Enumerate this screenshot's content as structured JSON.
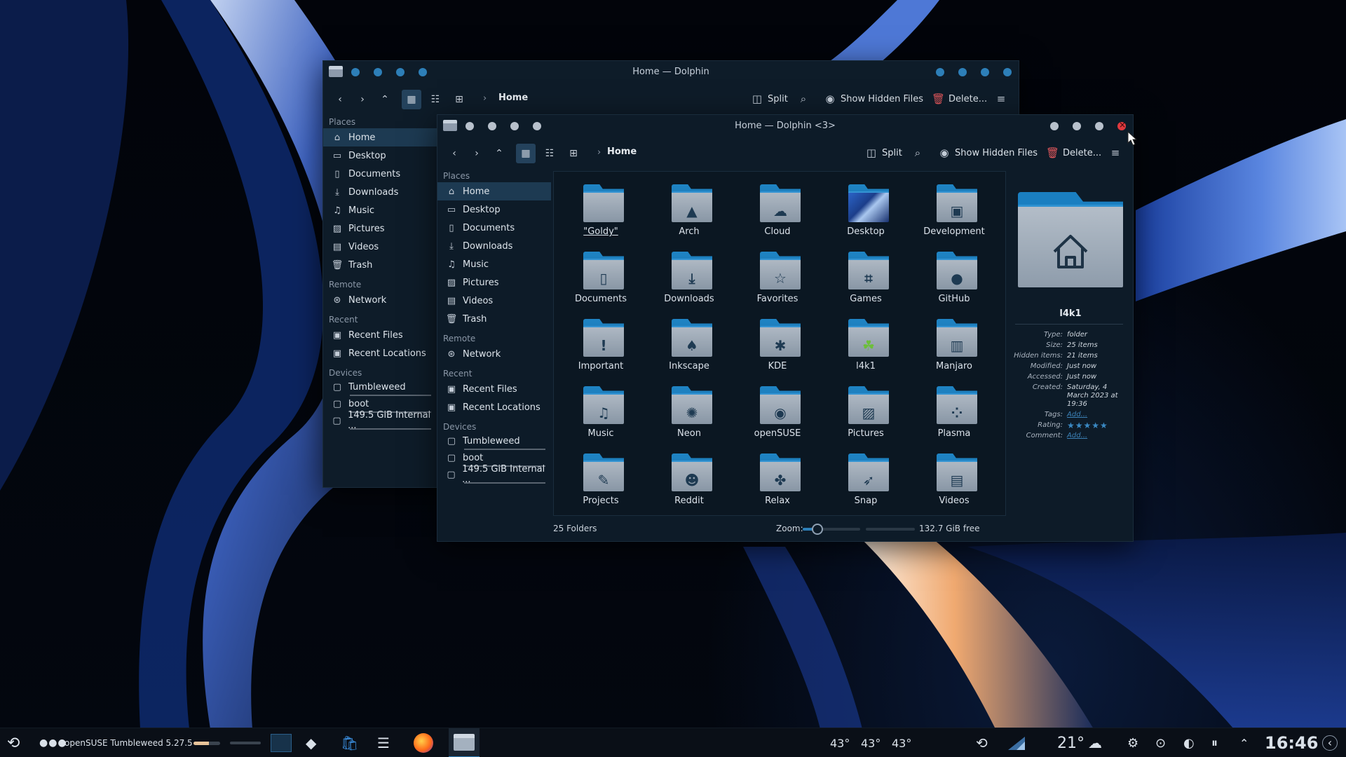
{
  "colors": {
    "accent": "#2d7fb8",
    "close": "#e0393e",
    "window_bg": "#0d1b28"
  },
  "back_window": {
    "title": "Home — Dolphin",
    "toolbar": {
      "split": "Split",
      "show_hidden": "Show Hidden Files",
      "delete": "Delete...",
      "breadcrumb": "Home"
    },
    "sidebar": {
      "places_title": "Places",
      "places": [
        "Home",
        "Desktop",
        "Documents",
        "Downloads",
        "Music",
        "Pictures",
        "Videos",
        "Trash"
      ],
      "remote_title": "Remote",
      "remote": [
        "Network"
      ],
      "recent_title": "Recent",
      "recent": [
        "Recent Files",
        "Recent Locations"
      ],
      "devices_title": "Devices",
      "devices": [
        "Tumbleweed",
        "boot",
        "149.5 GiB Internal ..."
      ]
    }
  },
  "front_window": {
    "title": "Home — Dolphin <3>",
    "toolbar": {
      "split": "Split",
      "show_hidden": "Show Hidden Files",
      "delete": "Delete...",
      "breadcrumb": "Home"
    },
    "sidebar": {
      "places_title": "Places",
      "places": [
        "Home",
        "Desktop",
        "Documents",
        "Downloads",
        "Music",
        "Pictures",
        "Videos",
        "Trash"
      ],
      "remote_title": "Remote",
      "remote": [
        "Network"
      ],
      "recent_title": "Recent",
      "recent": [
        "Recent Files",
        "Recent Locations"
      ],
      "devices_title": "Devices",
      "devices": [
        "Tumbleweed",
        "boot",
        "149.5 GiB Internal ..."
      ]
    },
    "folders": [
      {
        "label": "\"Goldy\"",
        "icon": "folder-icon"
      },
      {
        "label": "Arch",
        "icon": "arch-icon"
      },
      {
        "label": "Cloud",
        "icon": "cloud-icon"
      },
      {
        "label": "Desktop",
        "icon": "desktop-icon"
      },
      {
        "label": "Development",
        "icon": "development-icon"
      },
      {
        "label": "Documents",
        "icon": "document-icon"
      },
      {
        "label": "Downloads",
        "icon": "download-icon"
      },
      {
        "label": "Favorites",
        "icon": "star-icon"
      },
      {
        "label": "Games",
        "icon": "gamepad-icon"
      },
      {
        "label": "GitHub",
        "icon": "github-icon"
      },
      {
        "label": "Important",
        "icon": "exclamation-icon"
      },
      {
        "label": "Inkscape",
        "icon": "inkscape-icon"
      },
      {
        "label": "KDE",
        "icon": "kde-icon"
      },
      {
        "label": "l4k1",
        "icon": "chameleon-icon"
      },
      {
        "label": "Manjaro",
        "icon": "manjaro-icon"
      },
      {
        "label": "Music",
        "icon": "music-note-icon"
      },
      {
        "label": "Neon",
        "icon": "neon-icon"
      },
      {
        "label": "openSUSE",
        "icon": "opensuse-icon"
      },
      {
        "label": "Pictures",
        "icon": "picture-icon"
      },
      {
        "label": "Plasma",
        "icon": "plasma-icon"
      },
      {
        "label": "Projects",
        "icon": "brush-icon"
      },
      {
        "label": "Reddit",
        "icon": "reddit-icon"
      },
      {
        "label": "Relax",
        "icon": "leaf-icon"
      },
      {
        "label": "Snap",
        "icon": "snap-icon"
      },
      {
        "label": "Videos",
        "icon": "film-icon"
      }
    ],
    "status": {
      "count": "25 Folders",
      "zoom_label": "Zoom:",
      "zoom_level": 0.25,
      "free_space": "132.7 GiB free",
      "free_fill": 0.0
    },
    "info": {
      "name": "l4k1",
      "rows": [
        {
          "key": "Type:",
          "value": "folder"
        },
        {
          "key": "Size:",
          "value": "25 items"
        },
        {
          "key": "Hidden items:",
          "value": "21 items"
        },
        {
          "key": "Modified:",
          "value": "Just now"
        },
        {
          "key": "Accessed:",
          "value": "Just now"
        },
        {
          "key": "Created:",
          "value": "Saturday, 4 March 2023 at 19:36"
        }
      ],
      "tags_key": "Tags:",
      "tags_value": "Add...",
      "rating_key": "Rating:",
      "rating_value": "★★★★★",
      "comment_key": "Comment:",
      "comment_value": "Add..."
    }
  },
  "taskbar": {
    "system_name": "openSUSE Tumbleweed 5.27.5",
    "temps": [
      "43°",
      "43°",
      "43°"
    ],
    "weather_temp": "21°",
    "clock": "16:46"
  }
}
